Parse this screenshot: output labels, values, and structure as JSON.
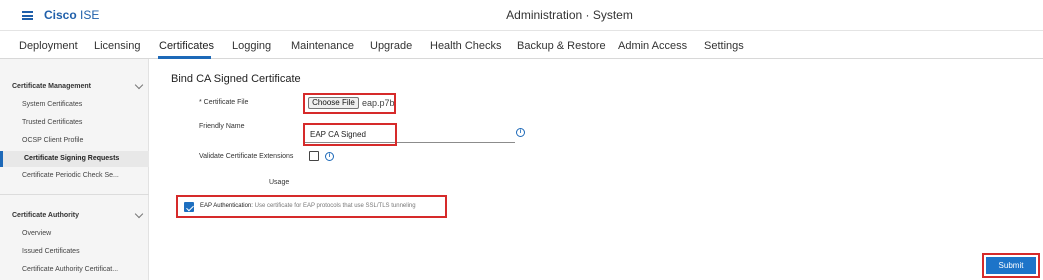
{
  "header": {
    "brand_bold": "Cisco",
    "brand_rest": " ISE",
    "title": "Administration · System"
  },
  "tabs": [
    {
      "label": "Deployment"
    },
    {
      "label": "Licensing"
    },
    {
      "label": "Certificates",
      "active": true
    },
    {
      "label": "Logging"
    },
    {
      "label": "Maintenance"
    },
    {
      "label": "Upgrade"
    },
    {
      "label": "Health Checks"
    },
    {
      "label": "Backup & Restore"
    },
    {
      "label": "Admin Access"
    },
    {
      "label": "Settings"
    }
  ],
  "sidebar": {
    "cert_mgmt": {
      "title": "Certificate Management",
      "items": [
        {
          "label": "System Certificates"
        },
        {
          "label": "Trusted Certificates"
        },
        {
          "label": "OCSP Client Profile"
        },
        {
          "label": "Certificate Signing Requests",
          "active": true
        },
        {
          "label": "Certificate Periodic Check Se..."
        }
      ]
    },
    "cert_auth": {
      "title": "Certificate Authority",
      "items": [
        {
          "label": "Overview"
        },
        {
          "label": "Issued Certificates"
        },
        {
          "label": "Certificate Authority Certificat..."
        }
      ]
    }
  },
  "form": {
    "title": "Bind CA Signed Certificate",
    "certificate_file_label": "* Certificate File",
    "choose_file_label": "Choose File",
    "file_name": "eap.p7b",
    "friendly_name_label": "Friendly Name",
    "friendly_name_value": "EAP CA Signed",
    "validate_label": "Validate Certificate Extensions",
    "validate_checked": false,
    "usage_label": "Usage",
    "eap_auth_label": "EAP Authentication:",
    "eap_auth_desc": " Use certificate for EAP protocols that use SSL/TLS tunneling",
    "eap_auth_checked": true,
    "info_glyph": "i",
    "submit_label": "Submit"
  },
  "colors": {
    "accent": "#1d69b8",
    "highlight_box": "#d62a2a"
  }
}
